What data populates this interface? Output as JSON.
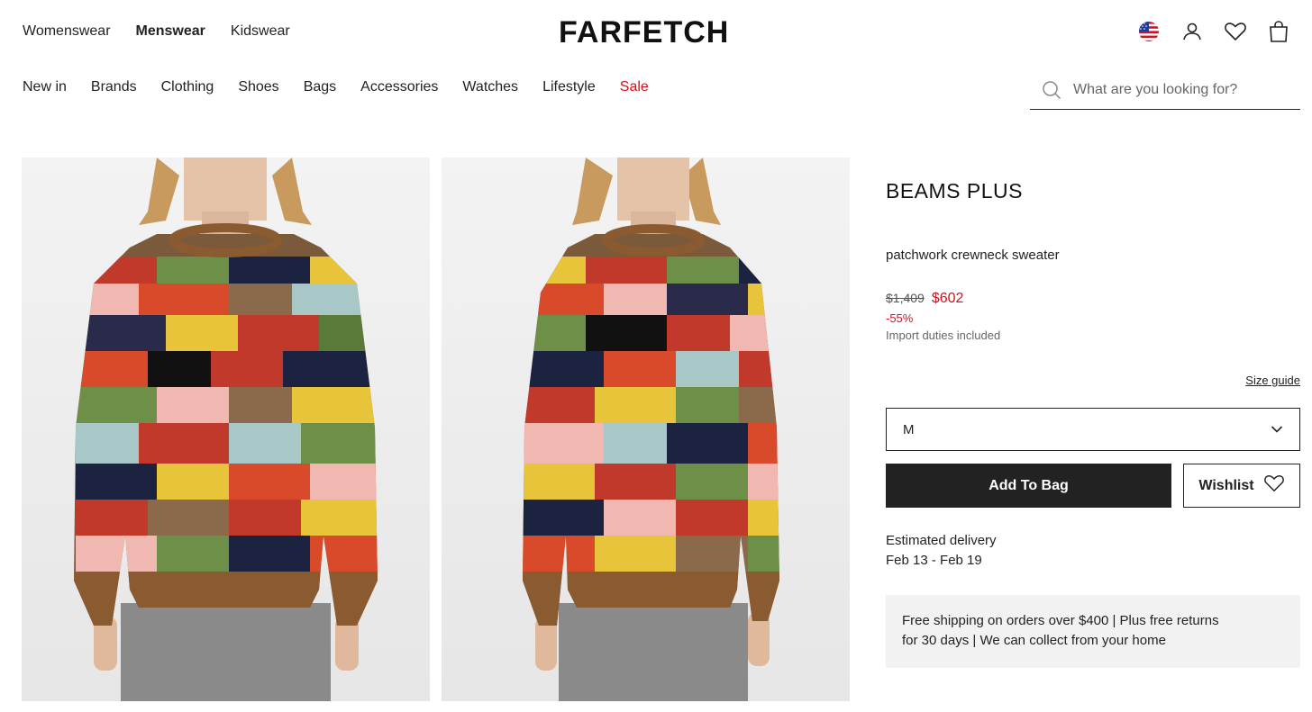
{
  "gender_nav": {
    "womenswear": "Womenswear",
    "menswear": "Menswear",
    "kidswear": "Kidswear"
  },
  "logo": "FARFETCH",
  "icons": {
    "flag": "us-flag-icon",
    "account": "user-icon",
    "wishlist": "heart-icon",
    "bag": "shopping-bag-icon",
    "search": "search-icon",
    "dropdown": "chevron-down-icon"
  },
  "category_nav": {
    "new_in": "New in",
    "brands": "Brands",
    "clothing": "Clothing",
    "shoes": "Shoes",
    "bags": "Bags",
    "accessories": "Accessories",
    "watches": "Watches",
    "lifestyle": "Lifestyle",
    "sale": "Sale"
  },
  "search": {
    "placeholder": "What are you looking for?"
  },
  "product": {
    "brand": "BEAMS PLUS",
    "name": "patchwork crewneck sweater",
    "original_price": "$1,409",
    "sale_price": "$602",
    "discount": "-55%",
    "duties_note": "Import duties included",
    "size_guide": "Size guide",
    "selected_size": "M",
    "add_to_bag": "Add To Bag",
    "wishlist": "Wishlist",
    "delivery_label": "Estimated delivery",
    "delivery_dates": "Feb 13 - Feb 19",
    "shipping_line1": "Free shipping on orders over $400 | Plus free returns",
    "shipping_line2": "for 30 days | We can collect from your home"
  },
  "colors": {
    "sale_red": "#d4111e",
    "button_dark": "#222222",
    "info_box": "#f2f2f2"
  }
}
